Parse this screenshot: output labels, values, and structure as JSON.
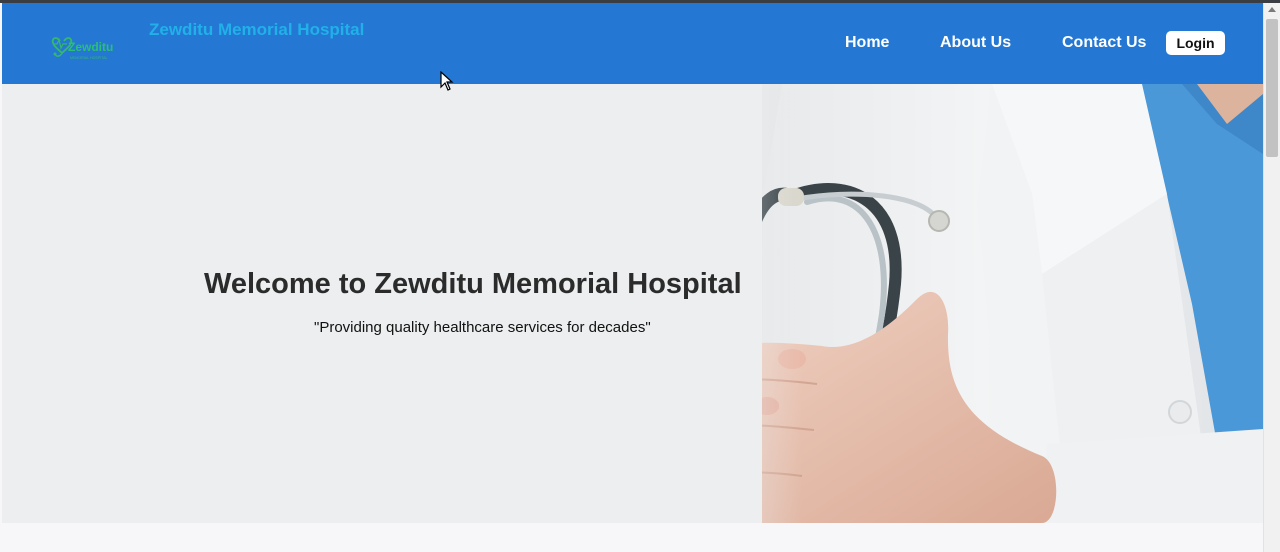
{
  "header": {
    "brand_title": "Zewditu Memorial Hospital",
    "logo": {
      "icon": "heart-stethoscope-icon",
      "text": "Zewditu",
      "subtext": "MEMORIAL HOSPITAL"
    },
    "nav": [
      {
        "label": "Home"
      },
      {
        "label": "About Us"
      },
      {
        "label": "Contact Us"
      }
    ],
    "login_label": "Login"
  },
  "hero": {
    "title": "Welcome to Zewditu Memorial Hospital",
    "subtitle": "\"Providing quality healthcare services for decades\"",
    "image": "doctor-with-stethoscope"
  },
  "colors": {
    "navbar": "#2478d4",
    "brand_text": "#21b0e8",
    "logo_green": "#35b86b"
  }
}
